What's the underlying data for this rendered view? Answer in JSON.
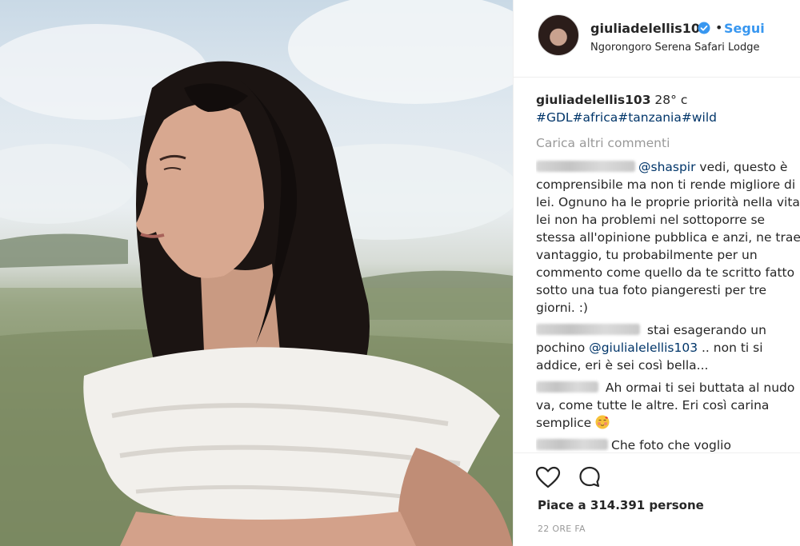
{
  "post": {
    "username": "giuliadelellis103",
    "follow_label": "Segui",
    "separator": "•",
    "location": "Ngorongoro Serena Safari Lodge",
    "caption_text": "28° c",
    "hashtags": "#GDL#africa#tanzania#wild",
    "load_more": "Carica altri commenti",
    "likes": "Piace a 314.391 persone",
    "timestamp": "22 ORE FA"
  },
  "comments": [
    {
      "mention": "@shaspir",
      "text": " vedi, questo è comprensibile ma non ti rende migliore di lei. Ognuno ha le proprie priorità nella vita, lei non ha problemi nel sottoporre se stessa all'opinione pubblica e anzi, ne trae vantaggio, tu probabilmente per un commento come quello da te scritto fatto sotto una tua foto piangeresti per tre giorni. :)"
    },
    {
      "text_before": " stai esagerando un pochino ",
      "mention": "@giulialelellis103",
      "text_after": " .. non ti si addice, eri è sei così bella..."
    },
    {
      "text": " Ah ormai ti sei buttata al nudo va, come tutte le altre. Eri così carina semplice"
    },
    {
      "text": "Che foto che voglio"
    }
  ],
  "colors": {
    "link_blue": "#3897f0",
    "hashtag_blue": "#003569",
    "muted": "#999999",
    "text": "#262626"
  },
  "icons": [
    "verified-badge-icon",
    "heart-icon",
    "comment-icon",
    "blushing-emoji-icon"
  ]
}
